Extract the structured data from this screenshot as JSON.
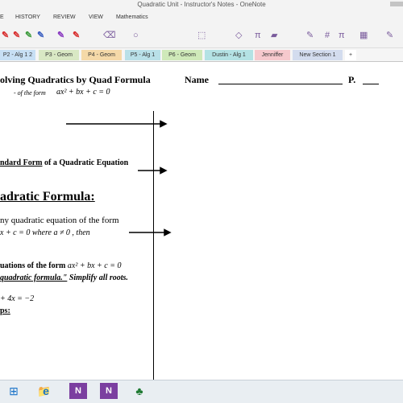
{
  "window": {
    "title": "Quadratic Unit - Instructor's Notes - OneNote"
  },
  "ribbon_tabs": [
    "E",
    "HISTORY",
    "REVIEW",
    "VIEW",
    "Mathematics"
  ],
  "toolbar_glyphs": {
    "pen1": "✎",
    "pen2": "✎",
    "pen3": "✎",
    "pen4": "✎",
    "pen5": "✎",
    "pen6": "✎",
    "eraser": "⌫",
    "lasso": "○",
    "select": "⬚",
    "shapes": "◇",
    "pi": "π",
    "highlight": "▰",
    "ink": "✎",
    "hash": "#",
    "eq": "π",
    "table": "▦",
    "compose": "✎"
  },
  "section_tabs": [
    {
      "label": "P2 - Alg 1 2",
      "color": "#c7dff4"
    },
    {
      "label": "P3 - Geom",
      "color": "#d9e8c4"
    },
    {
      "label": "P4 - Geom",
      "color": "#f5d9a8"
    },
    {
      "label": "P5 - Alg 1",
      "color": "#b9e0e8"
    },
    {
      "label": "P6 - Geom",
      "color": "#cfe9b9"
    },
    {
      "label": "Dustin - Alg 1",
      "color": "#b4e2e4"
    },
    {
      "label": "Jenniffer",
      "color": "#f6c9cd"
    },
    {
      "label": "New Section 1",
      "color": "#d3dcee"
    },
    {
      "label": "+",
      "color": "#ffffff"
    }
  ],
  "page": {
    "title": "olving Quadratics by Quad Formula",
    "name_label": "Name",
    "p_label": "P.",
    "form_of_label": "- of the form",
    "form_equation": "ax² + bx + c = 0",
    "standard_form_prefix": "ndard Form",
    "standard_form_suffix": " of a Quadratic Equation",
    "qf_heading": "adratic Formula:",
    "any_quadratic": "ny quadratic equation of the form",
    "line_eq": "x + c = 0   where    a ≠ 0  ,   then",
    "eq_of_form_prefix": "uations of the form ",
    "eq_of_form_expr": "ax² + bx + c = 0",
    "qf_simplify_prefix": "quadratic formula.\"",
    "qf_simplify_suffix": " Simplify all roots.",
    "example": "+ 4x = −2",
    "steps": "ps:"
  },
  "taskbar": {
    "icons": [
      "start-icon",
      "file-explorer-icon",
      "internet-explorer-icon",
      "onenote-icon",
      "onenote-2-icon",
      "game-icon"
    ],
    "glyphs": [
      "⊞",
      "📁",
      "e",
      "N",
      "N",
      "♣"
    ]
  }
}
